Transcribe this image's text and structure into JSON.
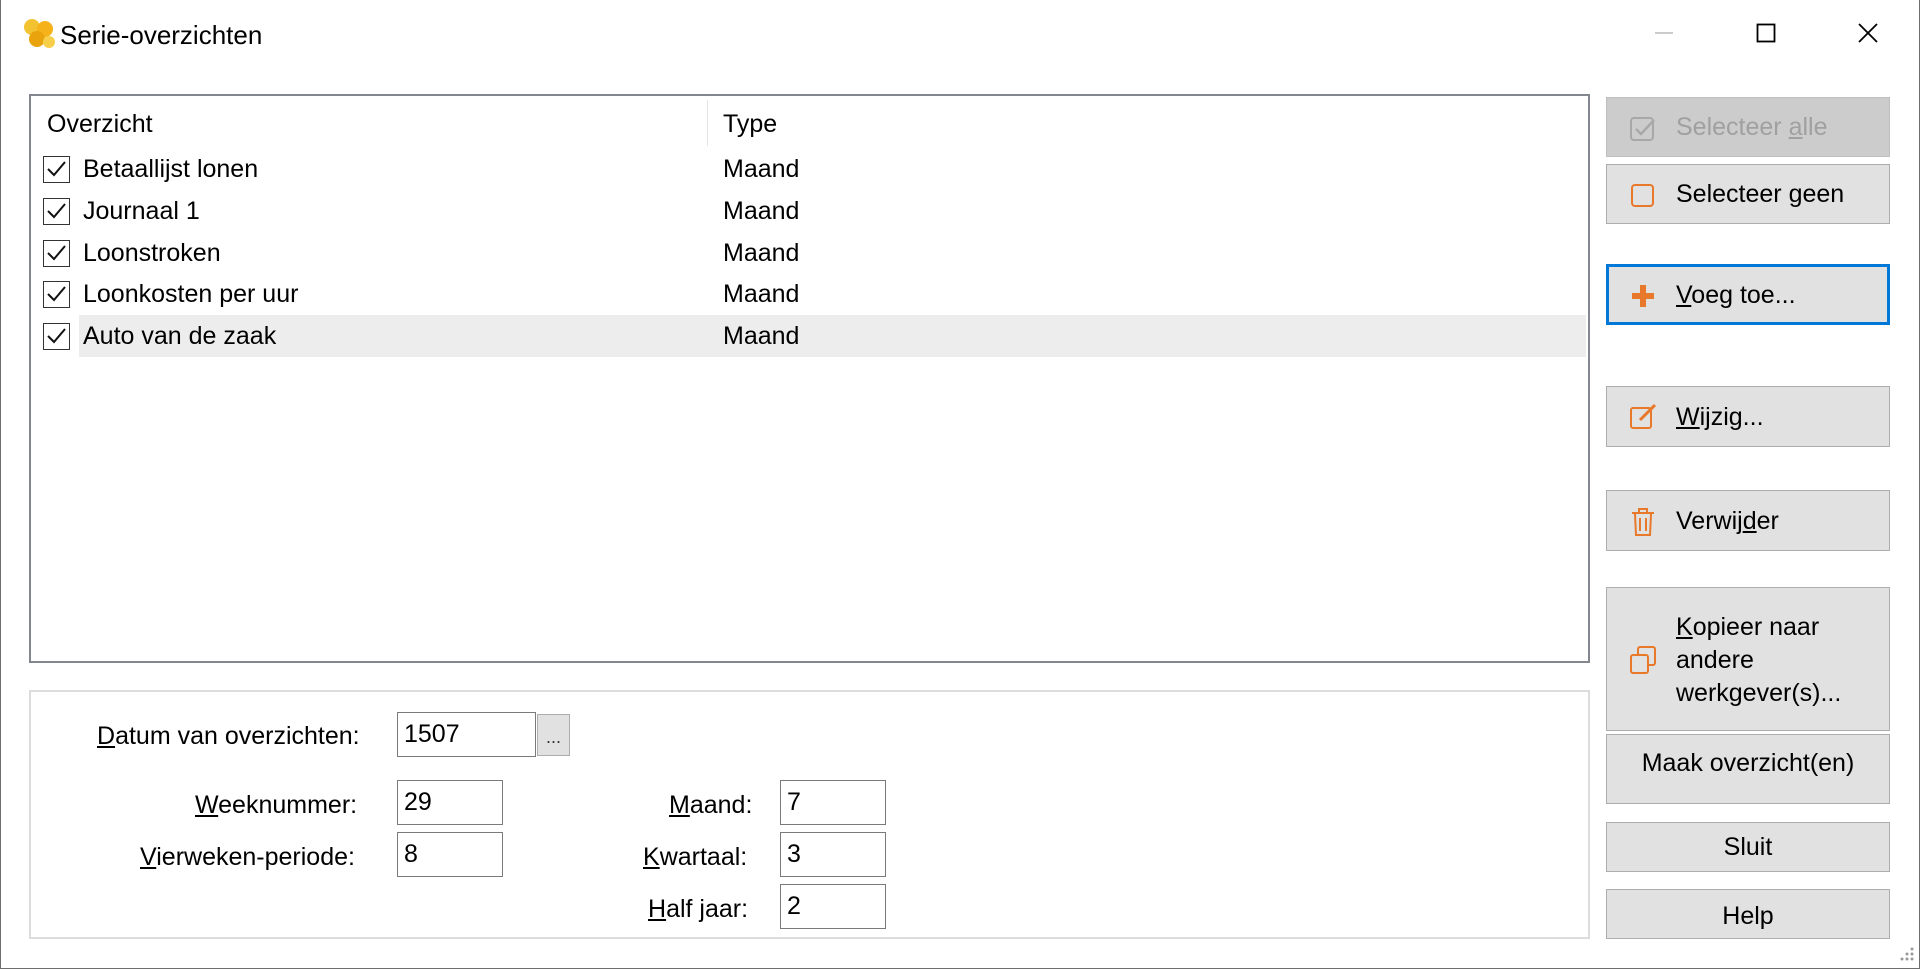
{
  "window": {
    "title": "Serie-overzichten",
    "icon": "yellow-app-icon"
  },
  "title_controls": {
    "minimize_icon": "minimize-icon",
    "maximize_icon": "maximize-icon",
    "close_icon": "close-icon"
  },
  "list": {
    "columns": [
      "Overzicht",
      "Type"
    ],
    "rows": [
      {
        "name": "Betaallijst lonen",
        "type": "Maand",
        "checked": true,
        "selected": false
      },
      {
        "name": "Journaal 1",
        "type": "Maand",
        "checked": true,
        "selected": false
      },
      {
        "name": "Loonstroken",
        "type": "Maand",
        "checked": true,
        "selected": false
      },
      {
        "name": "Loonkosten per uur",
        "type": "Maand",
        "checked": true,
        "selected": false
      },
      {
        "name": "Auto van de zaak",
        "type": "Maand",
        "checked": true,
        "selected": true
      }
    ]
  },
  "form": {
    "datum_label_u": "D",
    "datum_label_rest": "atum van overzichten:",
    "datum_value": "1507",
    "datum_button": "...",
    "week_label_u": "W",
    "week_label_rest": "eeknummer:",
    "week_value": "29",
    "vierweken_label_u": "V",
    "vierweken_label_rest": "ierweken-periode:",
    "vierweken_value": "8",
    "maand_label_u": "M",
    "maand_label_rest": "aand:",
    "maand_value": "7",
    "kwartaal_label_u": "K",
    "kwartaal_label_rest": "wartaal:",
    "kwartaal_value": "3",
    "halfjaar_label_u": "H",
    "halfjaar_label_rest": "alf jaar:",
    "halfjaar_value": "2"
  },
  "buttons": {
    "select_all_a": "Selecteer ",
    "select_all_u": "a",
    "select_all_b": "lle",
    "select_none_a": "Selecteer ",
    "select_none_u": "g",
    "select_none_b": "een",
    "add_u": "V",
    "add_b": "oeg toe...",
    "edit_u": "W",
    "edit_b": "ijzig...",
    "delete_a": "Verwij",
    "delete_u": "d",
    "delete_b": "er",
    "copy_u": "K",
    "copy_line1_rest": "opieer naar",
    "copy_line2": "andere",
    "copy_line3": "werkgever(s)...",
    "make": "Maak overzicht(en)",
    "close": "Sluit",
    "help": "Help"
  },
  "colors": {
    "accent_orange": "#e8792a",
    "focus_blue": "#0078d7",
    "disabled_gray": "#a0a0a0"
  }
}
